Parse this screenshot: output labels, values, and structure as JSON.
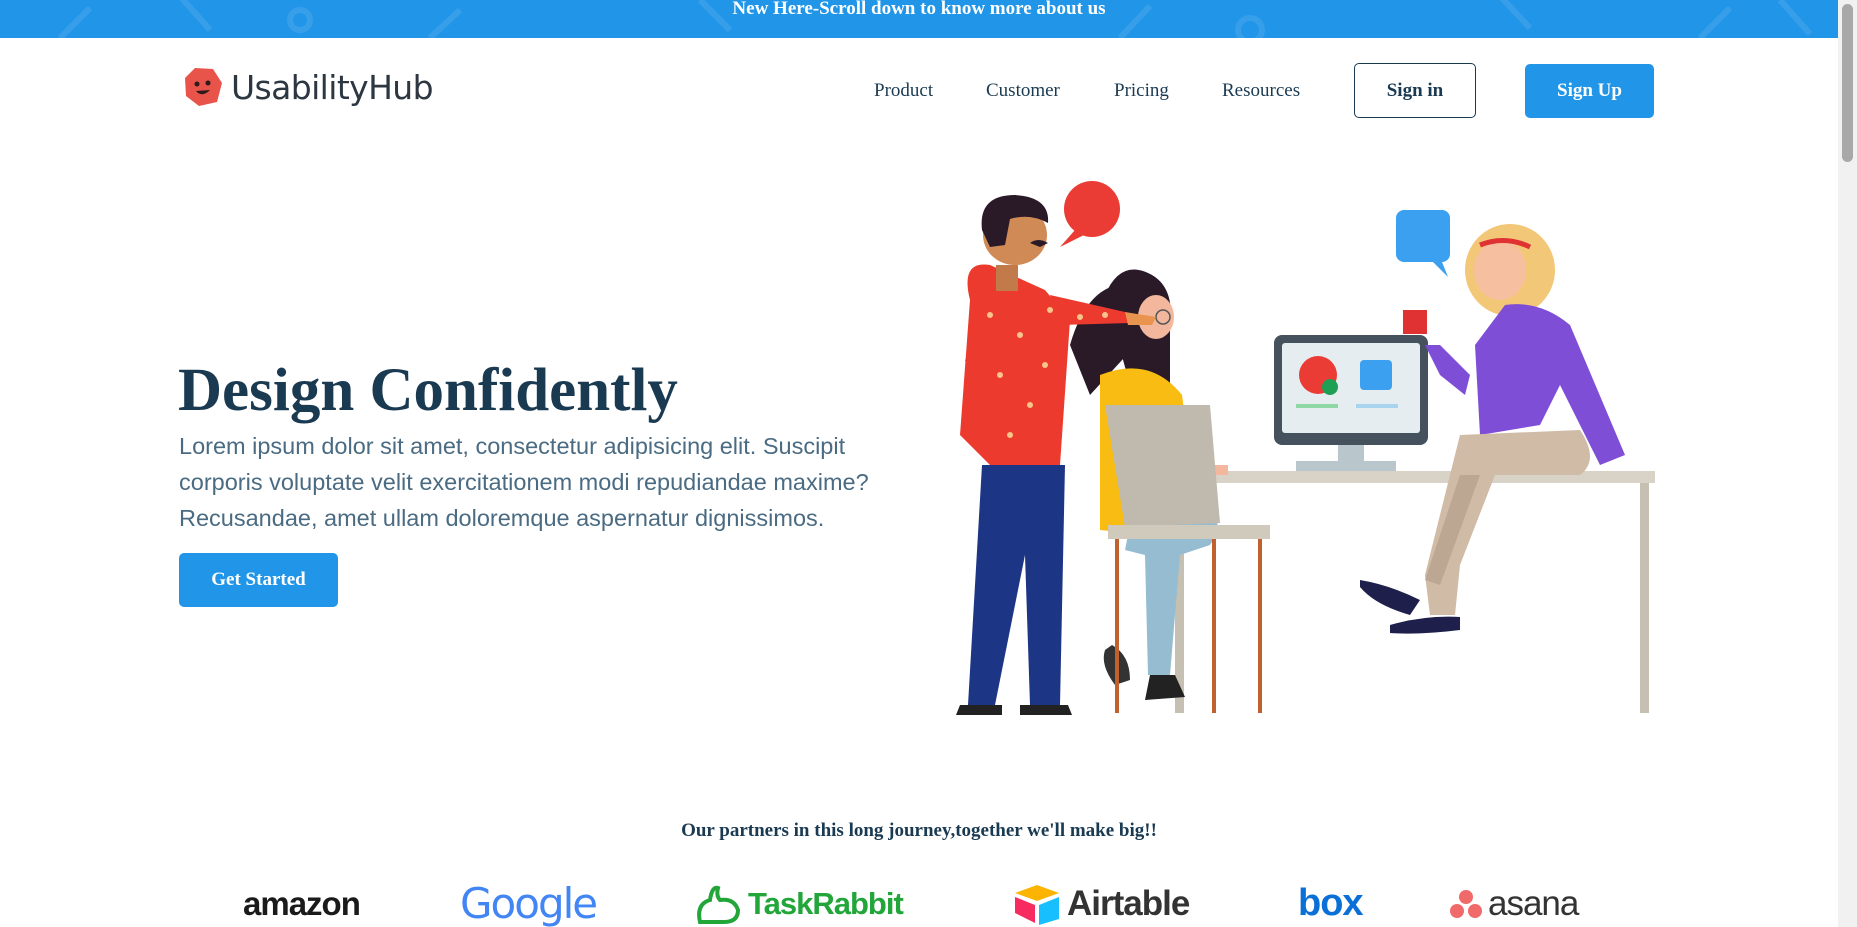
{
  "banner": {
    "text": "New Here-Scroll down to know more about us"
  },
  "header": {
    "logo_text": "UsabilityHub",
    "nav": [
      "Product",
      "Customer",
      "Pricing",
      "Resources"
    ],
    "signin_label": "Sign in",
    "signup_label": "Sign Up"
  },
  "hero": {
    "title": "Design Confidently",
    "description": "Lorem ipsum dolor sit amet, consectetur adipisicing elit. Suscipit corporis voluptate velit exercitationem modi repudiandae maxime? Recusandae, amet ullam doloremque aspernatur dignissimos.",
    "cta_label": "Get Started"
  },
  "partners": {
    "title": "Our partners in this long journey,together we'll make big!!",
    "logos": [
      {
        "name": "amazon"
      },
      {
        "name": "Google"
      },
      {
        "name": "TaskRabbit"
      },
      {
        "name": "Airtable"
      },
      {
        "name": "box"
      },
      {
        "name": "asana"
      }
    ]
  },
  "colors": {
    "accent": "#2196e8",
    "heading": "#1a3a52",
    "body_text": "#4a6b82",
    "logo_red": "#e8534a"
  }
}
